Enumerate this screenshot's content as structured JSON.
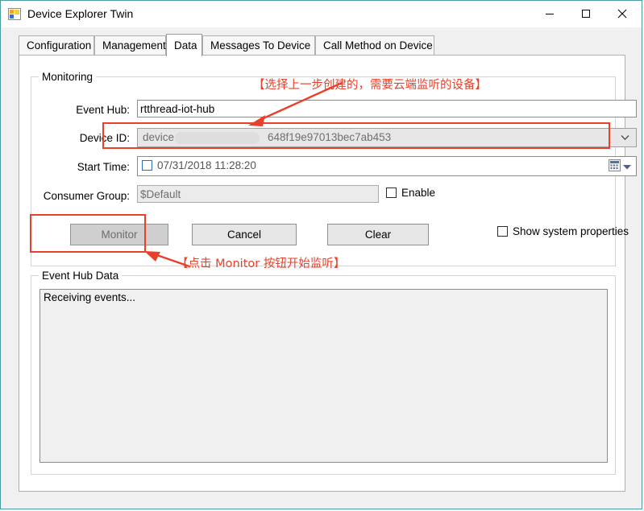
{
  "window": {
    "title": "Device Explorer Twin",
    "icon": "application-form-icon",
    "controls": {
      "minimize": "minimize-icon",
      "maximize": "maximize-icon",
      "close": "close-icon"
    }
  },
  "tabs": [
    {
      "label": "Configuration",
      "active": false
    },
    {
      "label": "Management",
      "active": false
    },
    {
      "label": "Data",
      "active": true
    },
    {
      "label": "Messages To Device",
      "active": false
    },
    {
      "label": "Call Method on Device",
      "active": false
    }
  ],
  "monitoring": {
    "group_title": "Monitoring",
    "event_hub": {
      "label": "Event Hub:",
      "value": "rtthread-iot-hub"
    },
    "device_id": {
      "label": "Device ID:",
      "value_prefix": "device",
      "value_suffix": "648f19e97013bec7ab453",
      "dropdown_icon": "chevron-down-icon"
    },
    "start_time": {
      "label": "Start Time:",
      "value": "07/31/2018 11:28:20",
      "checked": false,
      "picker_icon": "calendar-icon",
      "picker_arrow_icon": "dropdown-arrow-icon"
    },
    "consumer_group": {
      "label": "Consumer Group:",
      "value": "$Default",
      "enable_label": "Enable",
      "enable_checked": false
    },
    "buttons": {
      "monitor": "Monitor",
      "monitor_disabled": true,
      "cancel": "Cancel",
      "clear": "Clear"
    },
    "show_system_properties": {
      "label": "Show system properties",
      "checked": false
    }
  },
  "event_hub_data": {
    "group_title": "Event Hub Data",
    "content": "Receiving events..."
  },
  "annotations": [
    {
      "id": "annot-device",
      "text": "【选择上一步创建的，需要云端监听的设备】"
    },
    {
      "id": "annot-monitor",
      "text": "【点击 Monitor 按钮开始监听】"
    }
  ],
  "colors": {
    "annotation_red": "#e8402a",
    "window_border": "#4a9ba5",
    "accent_blue": "#2a6fb5"
  }
}
